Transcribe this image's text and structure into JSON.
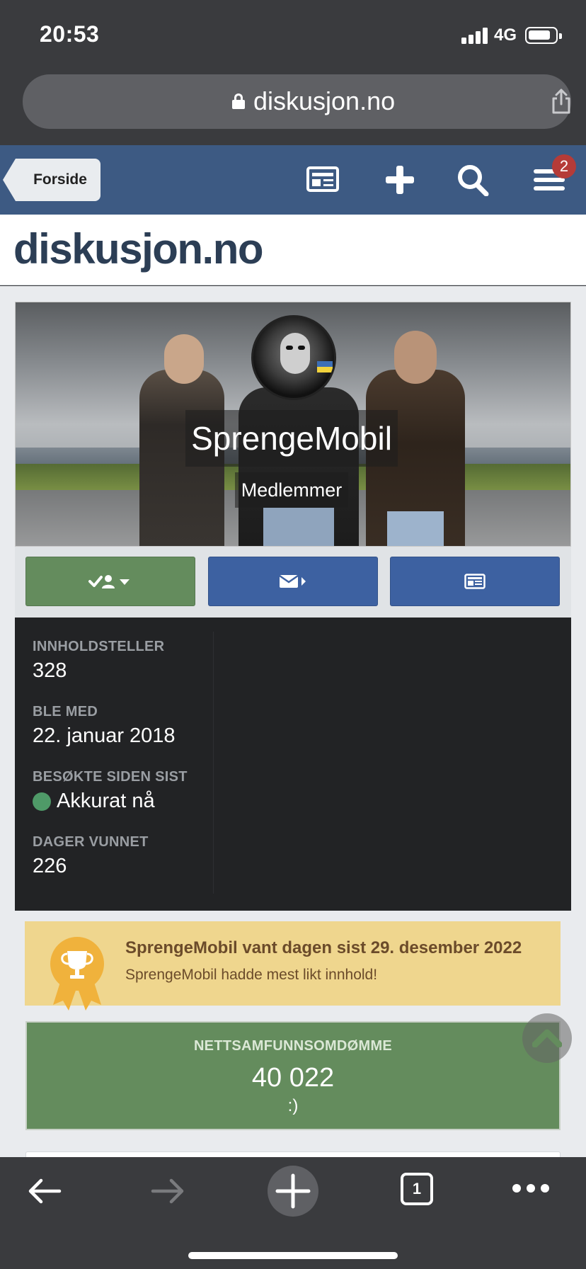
{
  "status": {
    "time": "20:53",
    "network": "4G",
    "icons": [
      "signal-icon",
      "battery-icon"
    ]
  },
  "browser": {
    "url": "diskusjon.no",
    "icons": [
      "lock-icon",
      "share-icon"
    ]
  },
  "site_nav": {
    "home_label": "Forside",
    "notification_count": "2",
    "icons": [
      "news-icon",
      "plus-icon",
      "search-icon",
      "menu-icon"
    ]
  },
  "logo": {
    "text": "diskusjon.no"
  },
  "profile": {
    "username": "SprengeMobil",
    "group": "Medlemmer",
    "action_icons": [
      "follow-icon",
      "message-icon",
      "content-icon"
    ]
  },
  "stats": [
    {
      "label": "INNHOLDSTELLER",
      "value": "328"
    },
    {
      "label": "BLE MED",
      "value": "22. januar 2018"
    },
    {
      "label": "BESØKTE SIDEN SIST",
      "value": "Akkurat nå"
    },
    {
      "label": "DAGER VUNNET",
      "value": "226"
    }
  ],
  "award": {
    "title": "SprengeMobil vant dagen sist 29. desember 2022",
    "subtitle": "SprengeMobil hadde mest likt innhold!"
  },
  "reputation": {
    "label": "NETTSAMFUNNSOMDØMME",
    "value": "40 022",
    "sub": ":)"
  },
  "toolbar": {
    "tabs_count": "1",
    "icons": [
      "back-icon",
      "forward-icon",
      "new-tab-icon",
      "tabs-icon",
      "more-icon"
    ]
  },
  "colors": {
    "nav_blue": "#3d5a83",
    "follow_green": "#648c5d",
    "button_blue": "#3d61a1",
    "award_yellow": "#efd68e",
    "badge_red": "#b53b38",
    "online_green": "#4f9a68"
  }
}
